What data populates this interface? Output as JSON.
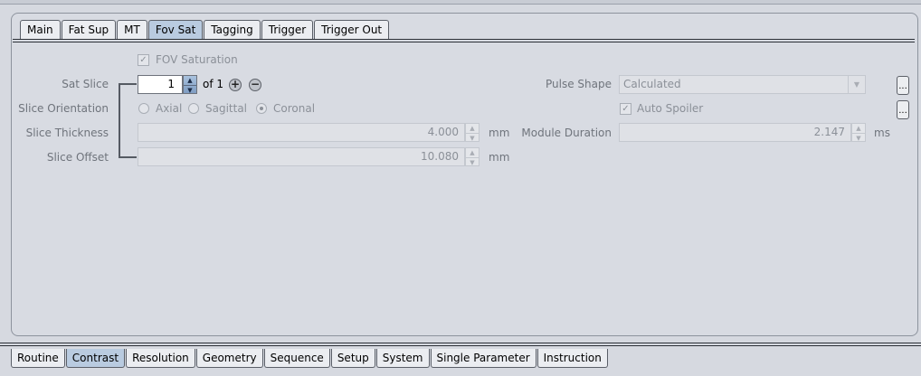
{
  "subtabs": [
    "Main",
    "Fat Sup",
    "MT",
    "Fov Sat",
    "Tagging",
    "Trigger",
    "Trigger Out"
  ],
  "subtabs_active": "Fov Sat",
  "fov_saturation": {
    "label": "FOV Saturation",
    "checked": true
  },
  "sat_slice": {
    "label": "Sat Slice",
    "value": "1",
    "of_text": "of 1",
    "add_icon": "plus-icon",
    "remove_icon": "minus-icon"
  },
  "slice_orientation": {
    "label": "Slice Orientation",
    "options": [
      "Axial",
      "Sagittal",
      "Coronal"
    ],
    "selected": "Coronal"
  },
  "slice_thickness": {
    "label": "Slice Thickness",
    "value": "4.000",
    "unit": "mm"
  },
  "slice_offset": {
    "label": "Slice Offset",
    "value": "10.080",
    "unit": "mm"
  },
  "pulse_shape": {
    "label": "Pulse Shape",
    "value": "Calculated"
  },
  "auto_spoiler": {
    "label": "Auto Spoiler",
    "checked": true
  },
  "module_duration": {
    "label": "Module Duration",
    "value": "2.147",
    "unit": "ms"
  },
  "ellipsis": "...",
  "bottom_tabs": [
    "Routine",
    "Contrast",
    "Resolution",
    "Geometry",
    "Sequence",
    "Setup",
    "System",
    "Single Parameter",
    "Instruction"
  ],
  "bottom_tabs_active": "Contrast",
  "colors": {
    "active_tab": "#b9cbe0",
    "background": "#d6d9e0",
    "disabled_text": "#8b9098"
  }
}
